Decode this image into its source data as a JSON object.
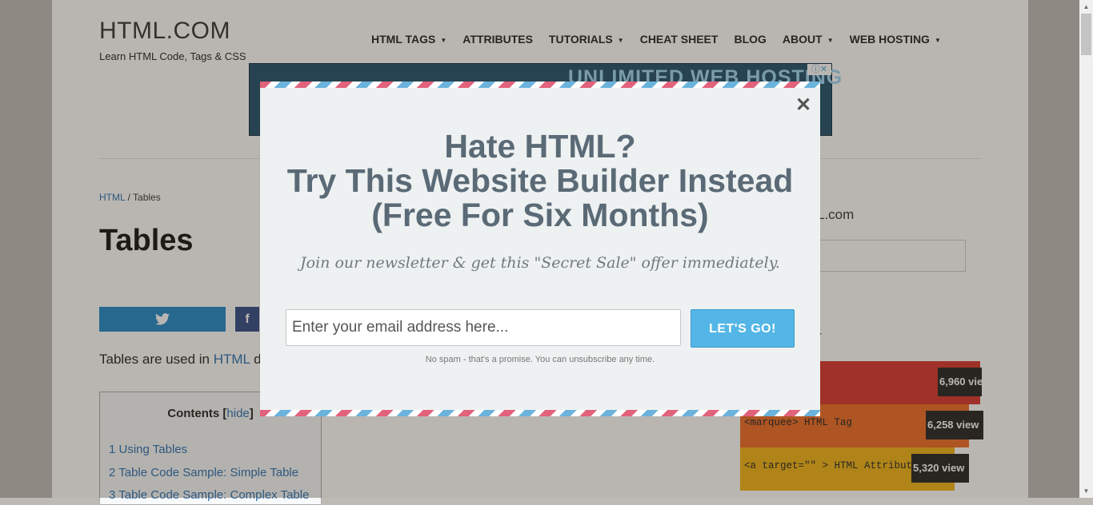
{
  "site": {
    "title": "HTML.COM",
    "tagline": "Learn HTML Code, Tags & CSS"
  },
  "nav": {
    "items": [
      {
        "label": "HTML TAGS",
        "dropdown": true
      },
      {
        "label": "ATTRIBUTES",
        "dropdown": false
      },
      {
        "label": "TUTORIALS",
        "dropdown": true
      },
      {
        "label": "CHEAT SHEET",
        "dropdown": false
      },
      {
        "label": "BLOG",
        "dropdown": false
      },
      {
        "label": "ABOUT",
        "dropdown": true
      },
      {
        "label": "WEB HOSTING",
        "dropdown": true
      }
    ]
  },
  "ad": {
    "text": "UNLIMITED WEB HOSTING"
  },
  "breadcrumb": {
    "root": "HTML",
    "separator": "/",
    "current": "Tables"
  },
  "page": {
    "title": "Tables",
    "intro_prefix": "Tables are used in",
    "intro_link": "HTML",
    "intro_suffix": "do"
  },
  "toc": {
    "title": "Contents",
    "hide_label": "hide",
    "items": [
      "1 Using Tables",
      "2 Table Code Sample: Simple Table",
      "3 Table Code Sample: Complex Table"
    ]
  },
  "sidebar": {
    "site_text": "L.com",
    "popular_heading": "r",
    "popular": [
      {
        "label": "",
        "views": "6,960 view",
        "color": "#d9342b"
      },
      {
        "label": "<marquee> HTML Tag",
        "views": "6,258 view",
        "color": "#ee6a24"
      },
      {
        "label": "<a target=\"\" > HTML Attribute",
        "views": "5,320 view",
        "color": "#f2b315"
      }
    ]
  },
  "modal": {
    "headline": [
      "Hate HTML?",
      "Try This Website Builder Instead",
      "(Free For Six Months)"
    ],
    "subline": "Join our newsletter & get this \"Secret Sale\" offer immediately.",
    "email_placeholder": "Enter your email address here...",
    "submit_label": "LET'S GO!",
    "spam_note": "No spam - that's a promise. You can unsubscribe any time.",
    "close_glyph": "✕"
  },
  "colors": {
    "accent": "#53b6e6",
    "headline": "#5a6a76",
    "stripe_red": "#e2627c",
    "stripe_blue": "#6bb3dc"
  }
}
